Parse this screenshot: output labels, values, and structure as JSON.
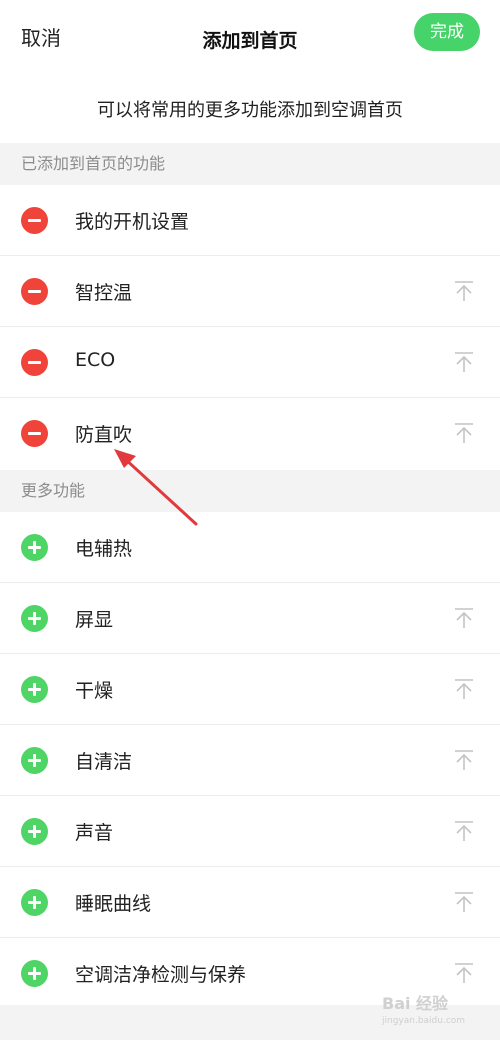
{
  "header": {
    "cancel_label": "取消",
    "title": "添加到首页",
    "done_label": "完成"
  },
  "hint": "可以将常用的更多功能添加到空调首页",
  "added_section": {
    "title": "已添加到首页的功能",
    "items": [
      {
        "label": "我的开机设置",
        "show_top": false
      },
      {
        "label": "智控温",
        "show_top": true
      },
      {
        "label": "ECO",
        "show_top": true
      },
      {
        "label": "防直吹",
        "show_top": true
      }
    ]
  },
  "more_section": {
    "title": "更多功能",
    "items": [
      {
        "label": "电辅热",
        "show_top": false
      },
      {
        "label": "屏显",
        "show_top": true
      },
      {
        "label": "干燥",
        "show_top": true
      },
      {
        "label": "自清洁",
        "show_top": true
      },
      {
        "label": "声音",
        "show_top": true
      },
      {
        "label": "睡眠曲线",
        "show_top": true
      },
      {
        "label": "空调洁净检测与保养",
        "show_top": true
      }
    ]
  },
  "colors": {
    "accent_green": "#46d36a",
    "remove_red": "#f0443a",
    "add_green": "#4fd466",
    "annotation_arrow": "#e0393e"
  },
  "watermark": {
    "main": "Bai 经验",
    "sub": "jingyan.baidu.com"
  }
}
